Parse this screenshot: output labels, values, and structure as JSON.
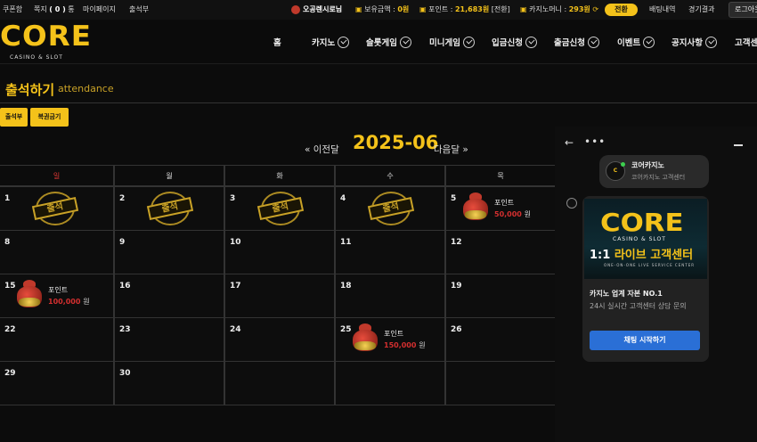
{
  "topbar": {
    "coupon": "쿠폰함",
    "memo_label": "쪽지",
    "memo_count": "( 0 )",
    "memo_unit": "통",
    "mypage": "마이페이지",
    "attendance": "출석부",
    "username": "오공렌시로님",
    "balance_label": "보유금액 :",
    "balance_value": "0원",
    "point_label": "포인트 :",
    "point_value": "21,683원",
    "point_convert": "[전환]",
    "casino_label": "카지노머니 :",
    "casino_value": "293원",
    "exchange": "전환",
    "bet_history": "배팅내역",
    "results": "경기결과",
    "login": "로그아웃"
  },
  "logo": {
    "word": "CORE",
    "sub": "CASINO & SLOT"
  },
  "nav": {
    "home": "홈",
    "casino": "카지노",
    "slot": "슬롯게임",
    "mini": "미니게임",
    "deposit": "입금신청",
    "withdraw": "출금신청",
    "event": "이벤트",
    "notice": "공지사항",
    "support": "고객센터"
  },
  "page": {
    "title": "출석하기",
    "title_en": "attendance",
    "btn_attendance": "출석부",
    "btn_lotto": "복권금기"
  },
  "calendar": {
    "prev": "« 이전달",
    "month": "2025-06",
    "next": "다음달 »",
    "weekdays": [
      "일",
      "월",
      "화",
      "수",
      "목"
    ],
    "stamp_label": "출석",
    "point_label": "포인트",
    "won": "원",
    "days": {
      "d1": "1",
      "d2": "2",
      "d3": "3",
      "d4": "4",
      "d5": "5",
      "d8": "8",
      "d9": "9",
      "d10": "10",
      "d11": "11",
      "d12": "12",
      "d15": "15",
      "d16": "16",
      "d17": "17",
      "d18": "18",
      "d19": "19",
      "d22": "22",
      "d23": "23",
      "d24": "24",
      "d25": "25",
      "d26": "26",
      "d29": "29",
      "d30": "30"
    },
    "points": {
      "p5": "50,000",
      "p15": "100,000",
      "p25": "150,000"
    }
  },
  "chat": {
    "back": "←",
    "more": "•••",
    "name": "코어카지노",
    "subtitle": "코어카지노 고객센터",
    "banner_word": "CORE",
    "banner_sub": "CASINO & SLOT",
    "banner_title_a": "1:1 ",
    "banner_title_b": "라이브 고객센터",
    "banner_en": "ONE-ON-ONE LIVE SERVICE CENTER",
    "heading": "카지노 업계 자본 NO.1",
    "body": "24시 실시간 고객센터 상담 문의",
    "start_button": "채팅 시작하기"
  },
  "colors": {
    "accent": "#f4c21a",
    "red": "#d32f2f",
    "chat_button": "#2a6fd6"
  }
}
